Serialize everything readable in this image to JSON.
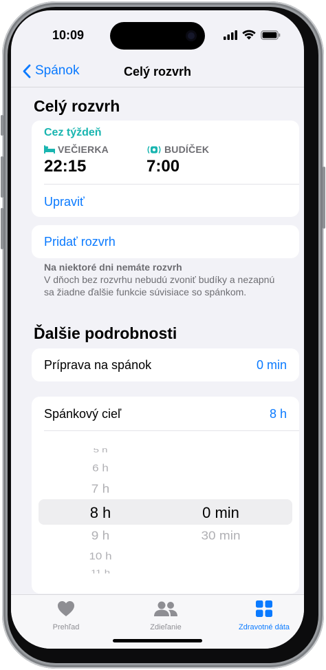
{
  "status_bar": {
    "time": "10:09"
  },
  "nav": {
    "back_label": "Spánok",
    "title": "Celý rozvrh"
  },
  "schedule_section": {
    "title": "Celý rozvrh",
    "period": "Cez týždeň",
    "bedtime": {
      "label": "VEČIERKA",
      "value": "22:15"
    },
    "wakeup": {
      "label": "BUDÍČEK",
      "value": "7:00"
    },
    "edit_label": "Upraviť",
    "add_schedule_label": "Pridať rozvrh",
    "note_title": "Na niektoré dni nemáte rozvrh",
    "note_text": "V dňoch bez rozvrhu nebudú zvoniť budíky a nezapnú sa žiadne ďalšie funkcie súvisiace so spánkom."
  },
  "details_section": {
    "title": "Ďalšie podrobnosti",
    "wind_down": {
      "label": "Príprava na spánok",
      "value": "0 min"
    },
    "sleep_goal": {
      "label": "Spánkový cieľ",
      "value": "8 h"
    }
  },
  "picker": {
    "hours": [
      "5 h",
      "6 h",
      "7 h",
      "8 h",
      "9 h",
      "10 h",
      "11 h"
    ],
    "minutes": [
      "0 min",
      "30 min"
    ],
    "selected_hour": "8 h",
    "selected_minute": "0 min"
  },
  "tab_bar": {
    "items": [
      {
        "label": "Prehľad",
        "icon": "heart-icon"
      },
      {
        "label": "Zdieľanie",
        "icon": "people-icon"
      },
      {
        "label": "Zdravotné dáta",
        "icon": "grid-icon"
      }
    ],
    "active_index": 2
  },
  "colors": {
    "accent": "#0a7aff",
    "teal": "#19b5b0"
  }
}
